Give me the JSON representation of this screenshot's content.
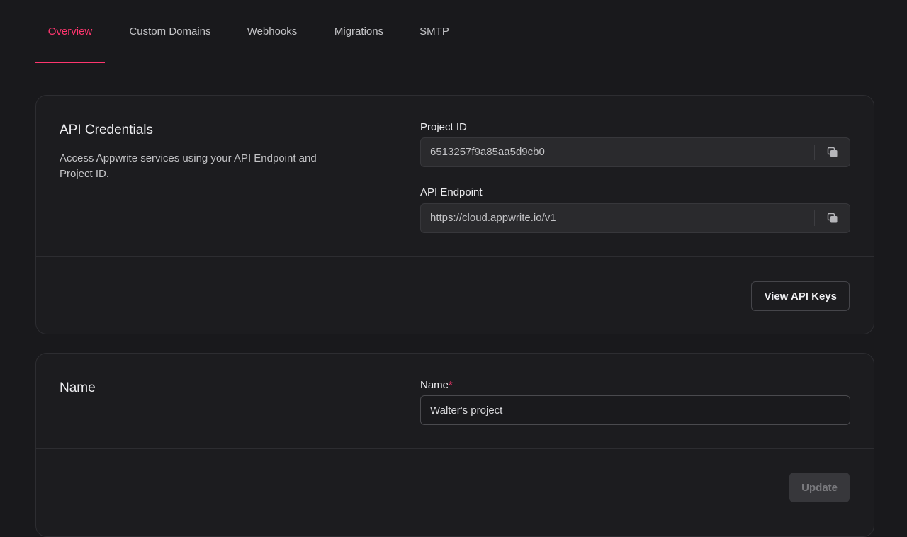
{
  "tabs": [
    {
      "label": "Overview",
      "active": true
    },
    {
      "label": "Custom Domains",
      "active": false
    },
    {
      "label": "Webhooks",
      "active": false
    },
    {
      "label": "Migrations",
      "active": false
    },
    {
      "label": "SMTP",
      "active": false
    }
  ],
  "api_credentials": {
    "title": "API Credentials",
    "description": "Access Appwrite services using your API Endpoint and Project ID.",
    "project_id_label": "Project ID",
    "project_id_value": "6513257f9a85aa5d9cb0",
    "endpoint_label": "API Endpoint",
    "endpoint_value": "https://cloud.appwrite.io/v1",
    "view_keys_label": "View API Keys"
  },
  "name_section": {
    "title": "Name",
    "field_label": "Name",
    "required_mark": "*",
    "field_value": "Walter's project",
    "update_label": "Update"
  },
  "colors": {
    "accent": "#fd366e",
    "background": "#19191c",
    "card": "#1c1c1f"
  },
  "icons": {
    "copy": "copy-icon"
  }
}
